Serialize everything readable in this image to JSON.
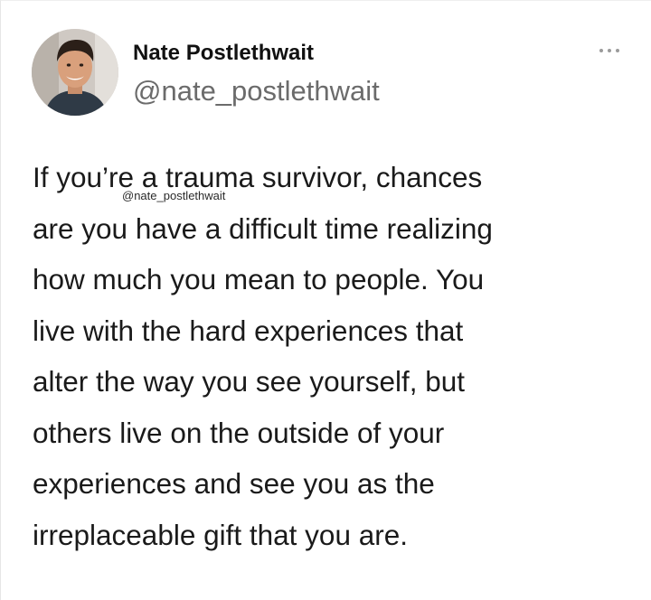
{
  "tweet": {
    "author": {
      "display_name": "Nate Postlethwait",
      "handle": "@nate_postlethwait",
      "avatar_icon": "profile-photo"
    },
    "more_icon": "more-horizontal-icon",
    "watermark": "@nate_postlethwait",
    "text": "If you’re a trauma survivor, chances\nare you have a difficult time realizing\nhow much you mean to people. You\nlive with the hard experiences that\nalter the way you see yourself, but\nothers live on the outside of your\nexperiences and see you as the\nirreplaceable gift that you are."
  },
  "colors": {
    "name": "#111111",
    "handle": "#6b6b6b",
    "body_text": "#1a1a1a",
    "icon": "#9b9b9b"
  }
}
